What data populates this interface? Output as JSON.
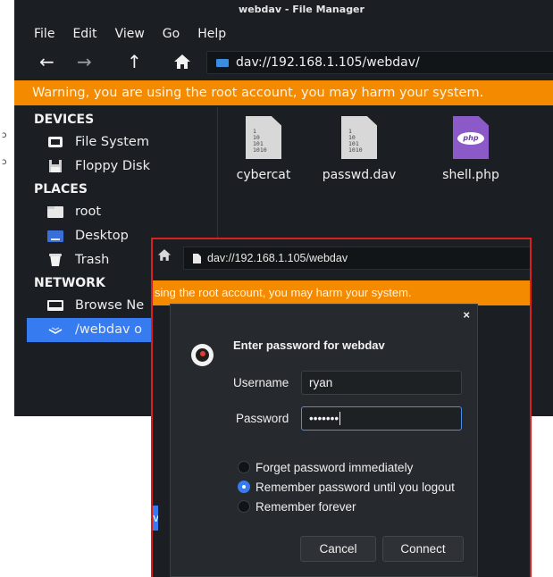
{
  "file_manager": {
    "title": "webdav - File Manager",
    "menu": [
      "File",
      "Edit",
      "View",
      "Go",
      "Help"
    ],
    "address": "dav://192.168.1.105/webdav/",
    "warning": "Warning, you are using the root account, you may harm your system.",
    "sidebar": {
      "devices_heading": "DEVICES",
      "devices": [
        "File System",
        "Floppy Disk"
      ],
      "places_heading": "PLACES",
      "places": [
        "root",
        "Desktop",
        "Trash"
      ],
      "network_heading": "NETWORK",
      "network": [
        "Browse Ne",
        "/webdav o"
      ]
    },
    "files": [
      {
        "name": "cybercat",
        "icon": "binary-file-icon"
      },
      {
        "name": "passwd.dav",
        "icon": "binary-file-icon"
      },
      {
        "name": "shell.php",
        "icon": "php-file-icon"
      }
    ],
    "binary_glyph": "1\n10\n101\n1010",
    "php_glyph": "php"
  },
  "overlay": {
    "address": "dav://192.168.1.105/webdav",
    "warning": "sing the root account, you may harm your system.",
    "left_edge_label": "vo"
  },
  "dialog": {
    "close_glyph": "×",
    "heading": "Enter password for webdav",
    "username_label": "Username",
    "username_value": "ryan",
    "password_label": "Password",
    "password_mask": "•••••••",
    "options": [
      {
        "label": "Forget password immediately",
        "selected": false
      },
      {
        "label": "Remember password until you logout",
        "selected": true
      },
      {
        "label": "Remember forever",
        "selected": false
      }
    ],
    "cancel_label": "Cancel",
    "connect_label": "Connect"
  },
  "colors": {
    "warning_orange": "#f48a00",
    "accent_blue": "#367bf0",
    "frame_red": "#d92020",
    "dark_bg": "#1b1f23"
  }
}
